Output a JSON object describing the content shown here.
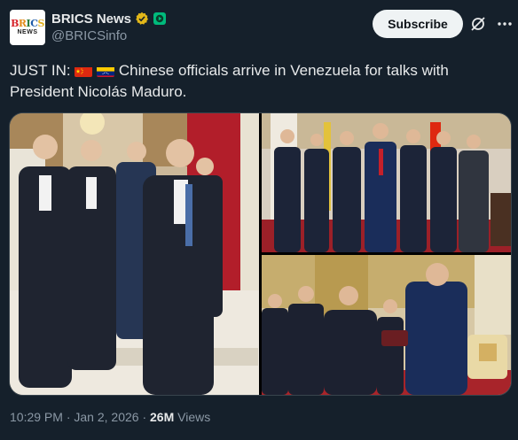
{
  "account": {
    "avatar_text_top": "BRICS",
    "avatar_text_bottom": "NEWS",
    "display_name": "BRICS News",
    "handle": "@BRICSinfo",
    "verified_badge": "gold-verified-badge-icon",
    "affiliate_badge": "green-affiliate-badge-icon"
  },
  "actions": {
    "subscribe_label": "Subscribe",
    "grok_icon": "grok-icon",
    "more_icon": "more-icon"
  },
  "tweet": {
    "prefix": "JUST IN:",
    "flags": [
      "china-flag-icon",
      "venezuela-flag-icon"
    ],
    "text": "Chinese officials arrive in Venezuela for talks with President Nicolás Maduro."
  },
  "media": {
    "photos": [
      {
        "name": "photo-delegation-walking"
      },
      {
        "name": "photo-group-portrait"
      },
      {
        "name": "photo-gift-exchange"
      }
    ]
  },
  "meta": {
    "time": "10:29 PM",
    "separator": "·",
    "date": "Jan 2, 2026",
    "views_count": "26M",
    "views_label": "Views"
  },
  "colors": {
    "background": "#15202b",
    "text": "#e7e9ea",
    "secondary_text": "#8b98a5",
    "button_bg": "#eff3f4",
    "verified_gold": "#e2b719",
    "affiliate_green": "#00ba7c"
  }
}
